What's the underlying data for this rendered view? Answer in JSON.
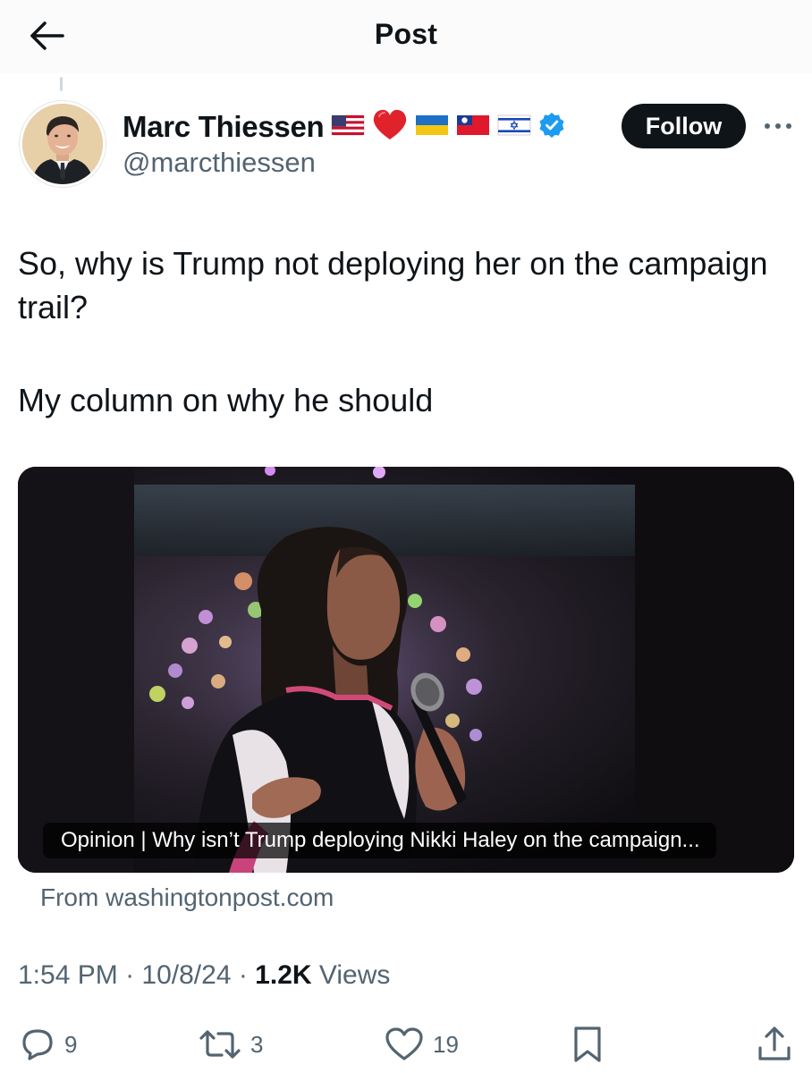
{
  "header": {
    "title": "Post",
    "back_icon": "arrow-left-icon"
  },
  "author": {
    "display_name": "Marc Thiessen",
    "handle": "@marcthiessen",
    "name_emoji": [
      "us-flag-icon",
      "red-heart-icon",
      "ukraine-flag-icon",
      "taiwan-flag-icon",
      "israel-flag-icon"
    ],
    "verified": true,
    "verified_color": "#1d9bf0",
    "follow_label": "Follow",
    "more_icon": "more-dots-icon"
  },
  "tweet": {
    "text_line1": "So, why is Trump not deploying her on the campaign trail?",
    "text_line2": "My column on why he should"
  },
  "link_card": {
    "headline": "Opinion | Why isn’t Trump deploying Nikki Haley on the campaign...",
    "source": "From washingtonpost.com"
  },
  "meta": {
    "time": "1:54 PM",
    "sep1": " · ",
    "date": "10/8/24",
    "sep2": " · ",
    "views_count": "1.2K",
    "views_label": " Views"
  },
  "actions": {
    "replies": "9",
    "reposts": "3",
    "likes": "19"
  },
  "colors": {
    "text": "#0f1419",
    "secondary": "#536471",
    "accent": "#1d9bf0",
    "follow_bg": "#0f1419"
  }
}
